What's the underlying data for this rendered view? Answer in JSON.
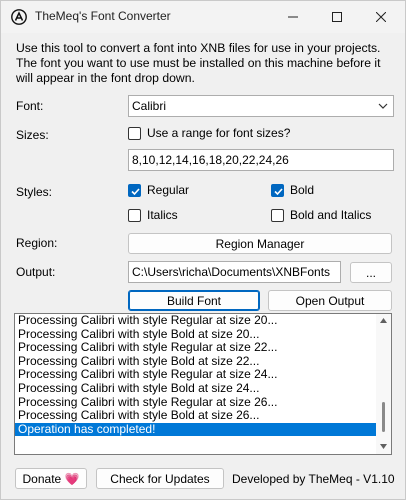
{
  "window": {
    "title": "TheMeq's Font Converter",
    "controls": {
      "minimize": "—",
      "maximize": "☐",
      "close": "✕"
    }
  },
  "description": "Use this tool to convert a font into XNB files for use in your projects. The font you want to use must be installed on this machine before it will appear in the font drop down.",
  "font": {
    "label": "Font:",
    "value": "Calibri"
  },
  "sizes": {
    "label": "Sizes:",
    "range_label": "Use a range for font sizes?",
    "range_checked": false,
    "value": "8,10,12,14,16,18,20,22,24,26"
  },
  "styles": {
    "label": "Styles:",
    "regular": {
      "label": "Regular",
      "checked": true
    },
    "bold": {
      "label": "Bold",
      "checked": true
    },
    "italics": {
      "label": "Italics",
      "checked": false
    },
    "bold_italics": {
      "label": "Bold and Italics",
      "checked": false
    }
  },
  "region": {
    "label": "Region:",
    "button": "Region Manager"
  },
  "output": {
    "label": "Output:",
    "path": "C:\\Users\\richa\\Documents\\XNBFonts",
    "browse": "..."
  },
  "actions": {
    "build": "Build Font",
    "open_output": "Open Output"
  },
  "log": {
    "lines": [
      "Processing Calibri with style Regular at size 20...",
      "Processing Calibri with style Bold at size 20...",
      "Processing Calibri with style Regular at size 22...",
      "Processing Calibri with style Bold at size 22...",
      "Processing Calibri with style Regular at size 24...",
      "Processing Calibri with style Bold at size 24...",
      "Processing Calibri with style Regular at size 26...",
      "Processing Calibri with style Bold at size 26...",
      "Operation has completed!"
    ],
    "selected_index": 8
  },
  "footer": {
    "donate": "Donate 💗",
    "check_updates": "Check for Updates",
    "credit": "Developed by TheMeq - V1.10"
  },
  "colors": {
    "accent": "#0067c0",
    "selection": "#0078d7"
  }
}
